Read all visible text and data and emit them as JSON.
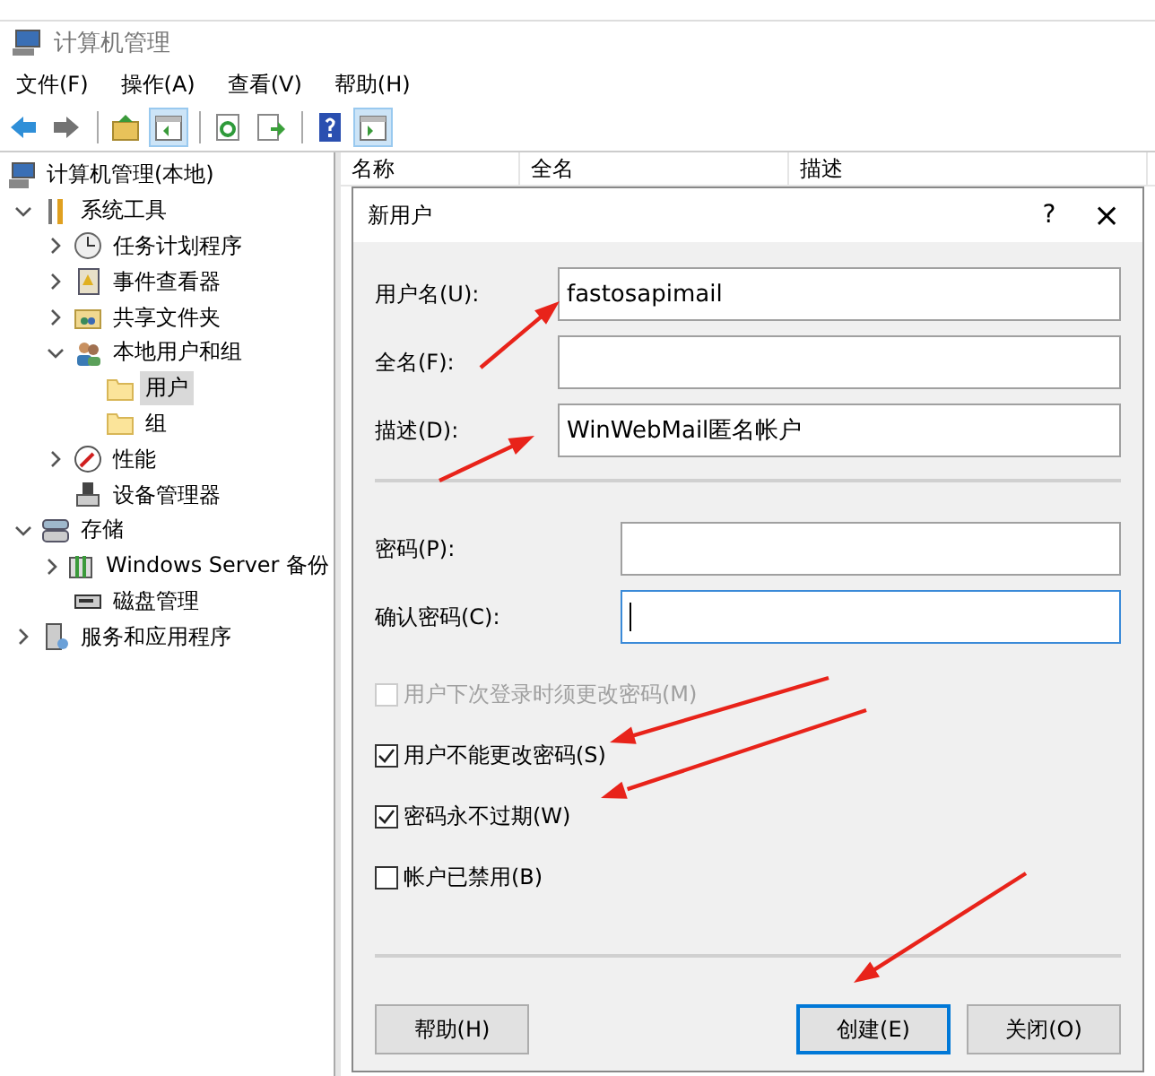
{
  "window": {
    "title": "计算机管理"
  },
  "menu": [
    "文件(F)",
    "操作(A)",
    "查看(V)",
    "帮助(H)"
  ],
  "toolbar": [
    {
      "kind": "back",
      "pressed": false,
      "disabled": false
    },
    {
      "kind": "forward",
      "pressed": false,
      "disabled": true
    },
    {
      "kind": "up",
      "pressed": false,
      "disabled": false
    },
    {
      "kind": "tree",
      "pressed": true,
      "disabled": false
    },
    {
      "kind": "refresh",
      "pressed": false,
      "disabled": false
    },
    {
      "kind": "export",
      "pressed": false,
      "disabled": false
    },
    {
      "kind": "help",
      "pressed": false,
      "disabled": false
    },
    {
      "kind": "pane",
      "pressed": true,
      "disabled": false
    }
  ],
  "tree": {
    "label": "计算机管理(本地)",
    "kind": "computer",
    "selected": false,
    "children": [
      {
        "label": "系统工具",
        "kind": "tools",
        "expanded": true,
        "selected": false,
        "children": [
          {
            "label": "任务计划程序",
            "kind": "clock",
            "expanded": false,
            "selected": false
          },
          {
            "label": "事件查看器",
            "kind": "log",
            "expanded": false,
            "selected": false
          },
          {
            "label": "共享文件夹",
            "kind": "share",
            "expanded": false,
            "selected": false
          },
          {
            "label": "本地用户和组",
            "kind": "users",
            "expanded": true,
            "selected": false,
            "children": [
              {
                "label": "用户",
                "kind": "folder",
                "selected": true
              },
              {
                "label": "组",
                "kind": "folder",
                "selected": false
              }
            ]
          },
          {
            "label": "性能",
            "kind": "gauge",
            "expanded": false,
            "selected": false
          },
          {
            "label": "设备管理器",
            "kind": "device",
            "selected": false
          }
        ]
      },
      {
        "label": "存储",
        "kind": "storage",
        "expanded": true,
        "selected": false,
        "children": [
          {
            "label": "Windows Server 备份",
            "kind": "backup",
            "expanded": false,
            "selected": false
          },
          {
            "label": "磁盘管理",
            "kind": "disk",
            "selected": false
          }
        ]
      },
      {
        "label": "服务和应用程序",
        "kind": "services",
        "expanded": false,
        "selected": false
      }
    ]
  },
  "list": {
    "columns": [
      "名称",
      "全名",
      "描述"
    ]
  },
  "dialog": {
    "title": "新用户",
    "help": "?",
    "close": "×",
    "field_groups": [
      [
        {
          "label": "用户名(U):",
          "value": "fastosapimail",
          "focused": false
        },
        {
          "label": "全名(F):",
          "focused": false
        },
        {
          "label": "描述(D):",
          "value": "WinWebMail匿名帐户",
          "focused": false
        }
      ],
      [
        {
          "label": "密码(P):",
          "focused": false
        },
        {
          "label": "确认密码(C):",
          "focused": true
        }
      ]
    ],
    "checkboxes": [
      {
        "label": "用户下次登录时须更改密码(M)",
        "checked": false,
        "disabled": true
      },
      {
        "label": "用户不能更改密码(S)",
        "checked": true,
        "disabled": false
      },
      {
        "label": "密码永不过期(W)",
        "checked": true,
        "disabled": false
      },
      {
        "label": "帐户已禁用(B)",
        "checked": false,
        "disabled": false
      }
    ],
    "buttons": [
      {
        "label": "帮助(H)",
        "default": false
      },
      {
        "label": "创建(E)",
        "default": true
      },
      {
        "label": "关闭(O)",
        "default": false
      }
    ]
  }
}
